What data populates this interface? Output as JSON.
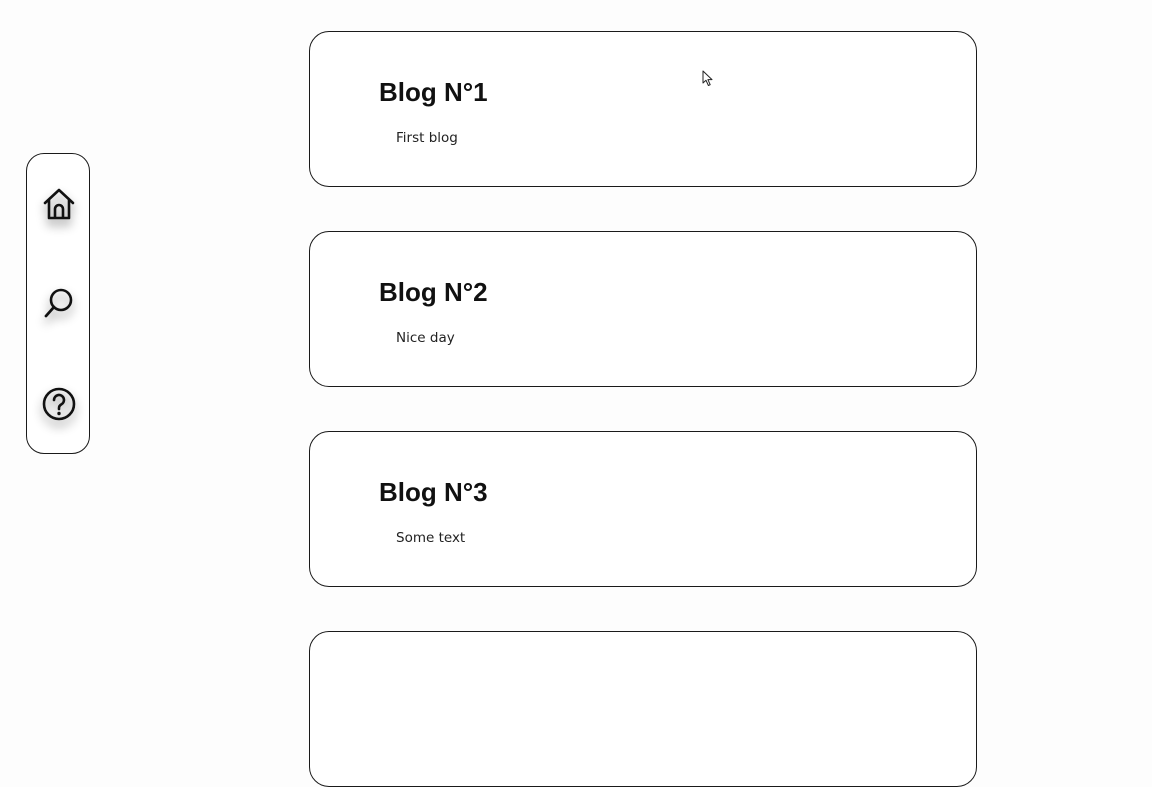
{
  "sidebar": {
    "items": [
      {
        "label": "Home",
        "icon": "home-icon"
      },
      {
        "label": "Search",
        "icon": "search-icon"
      },
      {
        "label": "Help",
        "icon": "question-icon"
      }
    ]
  },
  "blogs": [
    {
      "title": "Blog N°1",
      "text": "First blog"
    },
    {
      "title": "Blog N°2",
      "text": "Nice day"
    },
    {
      "title": "Blog N°3",
      "text": "Some text"
    },
    {
      "title": "",
      "text": ""
    }
  ],
  "colors": {
    "background": "#fdfdfd",
    "card": "#ffffff",
    "border": "#1a1a1a",
    "text": "#111111"
  }
}
